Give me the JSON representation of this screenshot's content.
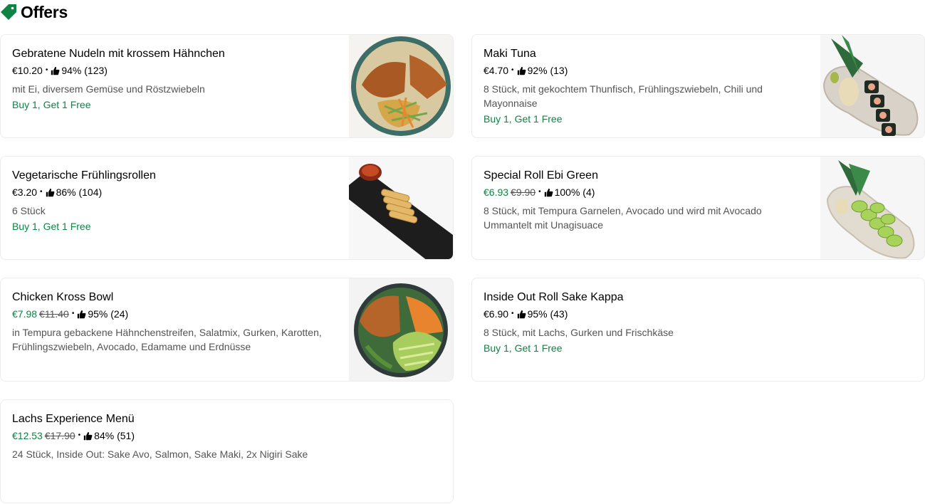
{
  "section": {
    "title": "Offers",
    "accent_color": "#0e8345"
  },
  "items": [
    {
      "name": "Gebratene Nudeln mit krossem Hähnchen",
      "price": "€10.20",
      "old_price": "",
      "rating": "94% (123)",
      "description": "mit Ei, diversem Gemüse und Röstzwiebeln",
      "promo": "Buy 1, Get 1 Free",
      "image": "noodles-chicken"
    },
    {
      "name": "Maki Tuna",
      "price": "€4.70",
      "old_price": "",
      "rating": "92% (13)",
      "description": "8 Stück, mit gekochtem Thunfisch, Frühlingszwiebeln, Chili und Mayonnaise",
      "promo": "Buy 1, Get 1 Free",
      "image": "maki-plate"
    },
    {
      "name": "Vegetarische Frühlingsrollen",
      "price": "€3.20",
      "old_price": "",
      "rating": "86% (104)",
      "description": "6 Stück",
      "promo": "Buy 1, Get 1 Free",
      "image": "spring-rolls"
    },
    {
      "name": "Special Roll Ebi Green",
      "price": "€6.93",
      "old_price": "€9.90",
      "rating": "100% (4)",
      "description": "8 Stück, mit Tempura Garnelen, Avocado und wird mit Avocado Ummantelt mit Unagisuace",
      "promo": "",
      "image": "green-roll-plate"
    },
    {
      "name": "Chicken Kross Bowl",
      "price": "€7.98",
      "old_price": "€11.40",
      "rating": "95% (24)",
      "description": "in Tempura gebackene Hähnchenstreifen, Salatmix, Gurken, Karotten, Frühlingszwiebeln, Avocado, Edamame und Erdnüsse",
      "promo": "",
      "image": "chicken-bowl"
    },
    {
      "name": "Inside Out Roll Sake Kappa",
      "price": "€6.90",
      "old_price": "",
      "rating": "95% (43)",
      "description": "8 Stück, mit Lachs, Gurken und Frischkäse",
      "promo": "Buy 1, Get 1 Free",
      "image": ""
    },
    {
      "name": "Lachs Experience Menü",
      "price": "€12.53",
      "old_price": "€17.90",
      "rating": "84% (51)",
      "description": "24 Stück, Inside Out: Sake Avo, Salmon, Sake Maki, 2x Nigiri Sake",
      "promo": "",
      "image": ""
    }
  ]
}
